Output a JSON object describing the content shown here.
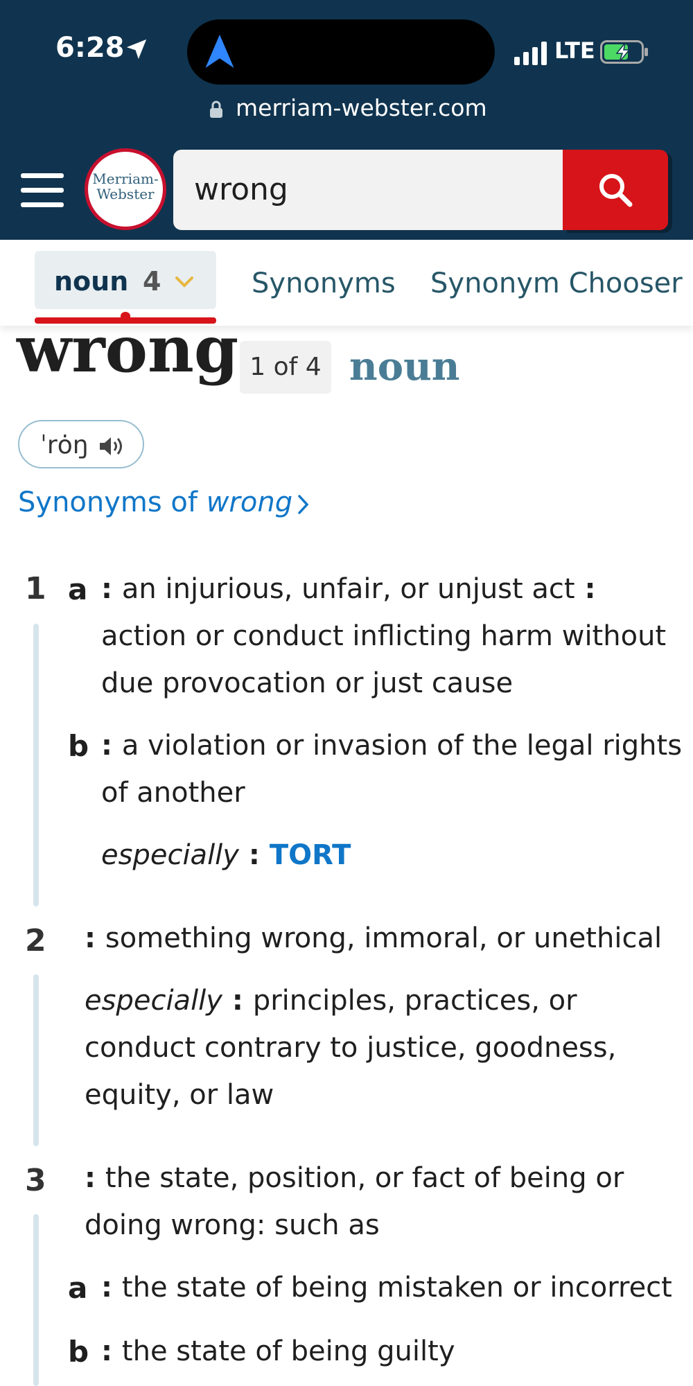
{
  "status_bar": {
    "time": "6:28",
    "network": "LTE",
    "battery_state": "charging",
    "battery_color": "#4cd964"
  },
  "browser": {
    "url": "merriam-webster.com"
  },
  "header": {
    "logo_line1": "Merriam-",
    "logo_line2": "Webster",
    "search_value": "wrong",
    "brand_color": "#10344f",
    "accent_color": "#d7141a"
  },
  "tabs": {
    "noun_label": "noun",
    "noun_count": "4",
    "synonyms": "Synonyms",
    "synonym_chooser": "Synonym Chooser"
  },
  "entry": {
    "headword": "wrong",
    "index": "1 of 4",
    "part_of_speech": "noun",
    "pronunciation": "ˈrȯŋ",
    "synonyms_link_prefix": "Synonyms of ",
    "synonyms_link_word": "wrong"
  },
  "definitions": {
    "s1": {
      "num": "1",
      "a_letter": "a",
      "a_line1": "an injurious, unfair, or unjust act",
      "a_line2": "action or conduct inflicting harm without",
      "a_line3": "due provocation or just cause",
      "b_letter": "b",
      "b_line1": "a violation or invasion of the legal rights",
      "b_line2": "of another",
      "b_sl": "especially",
      "b_xref": "TORT"
    },
    "s2": {
      "num": "2",
      "line1": "something wrong, immoral, or unethical",
      "sl": "especially",
      "line2": "principles, practices, or",
      "line3": "conduct contrary to justice, goodness,",
      "line4": "equity, or law"
    },
    "s3": {
      "num": "3",
      "line1": "the state, position, or fact of being or",
      "line2": "doing wrong: such as",
      "a_letter": "a",
      "a_line": "the state of being mistaken or incorrect",
      "b_letter": "b",
      "b_line": "the state of being guilty"
    }
  }
}
